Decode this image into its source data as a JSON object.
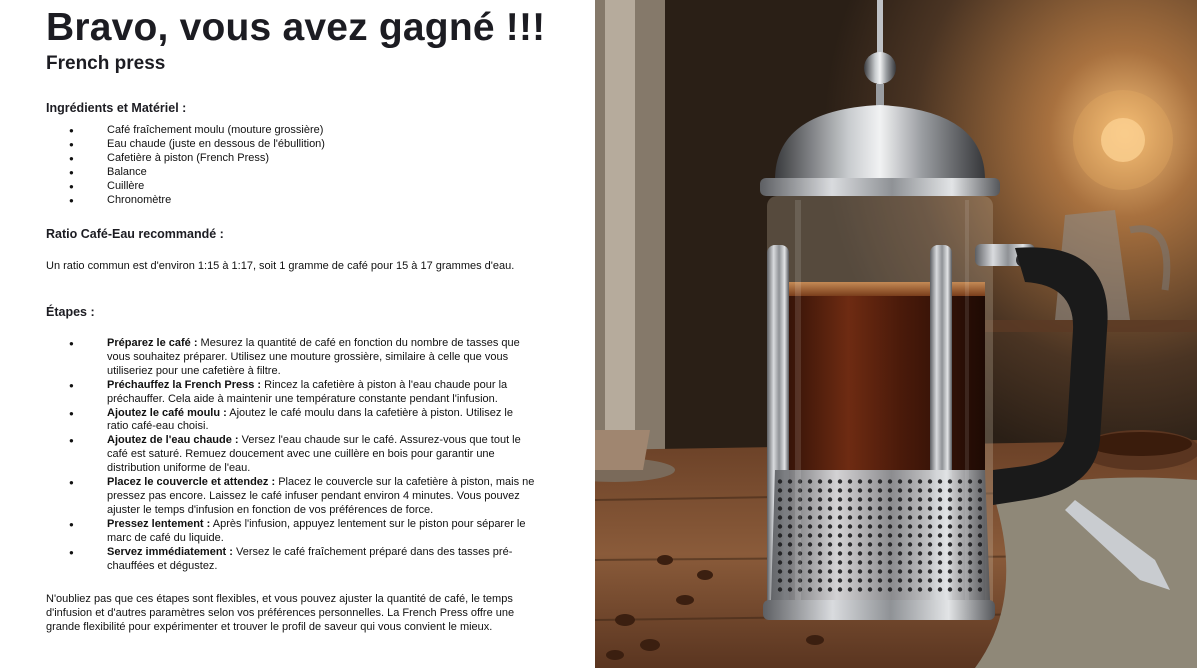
{
  "header": {
    "title": "Bravo, vous avez gagné !!!",
    "subtitle": "French press"
  },
  "ingredients": {
    "heading": "Ingrédients et Matériel :",
    "items": [
      "Café fraîchement moulu (mouture grossière)",
      "Eau chaude (juste en dessous de l'ébullition)",
      "Cafetière à piston (French Press)",
      "Balance",
      "Cuillère",
      "Chronomètre"
    ]
  },
  "ratio": {
    "heading": "Ratio Café-Eau recommandé :",
    "text": "Un ratio commun est d'environ 1:15 à 1:17, soit 1 gramme de café pour 15 à 17 grammes d'eau."
  },
  "steps": {
    "heading": "Étapes :",
    "items": [
      {
        "label": "Préparez le café :",
        "text": " Mesurez la quantité de café en fonction du nombre de tasses que vous souhaitez préparer. Utilisez une mouture grossière, similaire à celle que vous utiliseriez pour une cafetière à filtre."
      },
      {
        "label": "Préchauffez la French Press :",
        "text": " Rincez la cafetière à piston à l'eau chaude pour la préchauffer. Cela aide à maintenir une température constante pendant l'infusion."
      },
      {
        "label": "Ajoutez le café moulu :",
        "text": " Ajoutez le café moulu dans la cafetière à piston. Utilisez le ratio café-eau choisi."
      },
      {
        "label": "Ajoutez de l'eau chaude :",
        "text": " Versez l'eau chaude sur le café. Assurez-vous que tout le café est saturé. Remuez doucement avec une cuillère en bois pour garantir une distribution uniforme de l'eau."
      },
      {
        "label": "Placez le couvercle et attendez :",
        "text": " Placez le couvercle sur la cafetière à piston, mais ne pressez pas encore. Laissez le café infuser pendant environ 4 minutes. Vous pouvez ajuster le temps d'infusion en fonction de vos préférences de force."
      },
      {
        "label": "Pressez lentement :",
        "text": " Après l'infusion, appuyez lentement sur le piston pour séparer le marc de café du liquide."
      },
      {
        "label": "Servez immédiatement :",
        "text": " Versez le café fraîchement préparé dans des tasses pré-chauffées et dégustez."
      }
    ]
  },
  "footer": {
    "text": "N'oubliez pas que ces étapes sont flexibles, et vous pouvez ajuster la quantité de café, le temps d'infusion et d'autres paramètres selon vos préférences personnelles. La French Press offre une grande flexibilité pour expérimenter et trouver le profil de saveur qui vous convient le mieux."
  },
  "image": {
    "subject": "french-press-photo",
    "colors": {
      "wood_light": "#8a5b3a",
      "wood_dark": "#3a2415",
      "background_dark": "#2e2218",
      "light_glow": "#f0b465",
      "steel": "#b9bcc0",
      "coffee": "#4a1d0d",
      "handle": "#1a1a1a"
    }
  }
}
